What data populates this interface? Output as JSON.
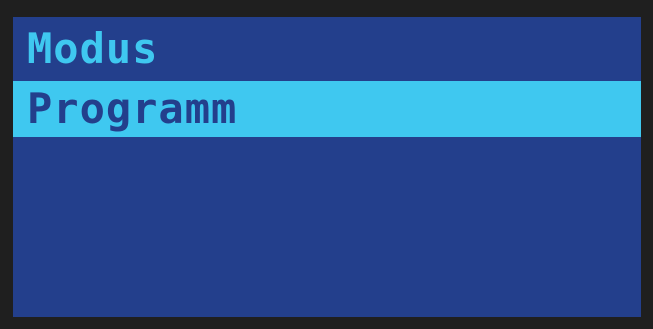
{
  "menu": {
    "items": [
      {
        "label": "Modus",
        "selected": false
      },
      {
        "label": "Programm",
        "selected": true
      }
    ]
  },
  "colors": {
    "screen_background": "#233f8c",
    "text": "#3fc8f0",
    "highlight_background": "#3fc8f0",
    "highlight_text": "#233f8c",
    "bezel": "#1f1f1f"
  }
}
